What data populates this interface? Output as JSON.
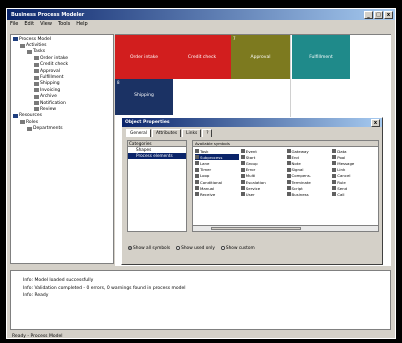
{
  "window": {
    "title": "Business Process Modeler",
    "controls": {
      "min": "_",
      "max": "□",
      "close": "x"
    }
  },
  "menubar": {
    "items": [
      "File",
      "Edit",
      "View",
      "Tools",
      "Help"
    ]
  },
  "tree": {
    "items": [
      {
        "label": "Process Model",
        "indent": 0,
        "icon": "b"
      },
      {
        "label": "Activities",
        "indent": 1,
        "icon": "g"
      },
      {
        "label": "Tasks",
        "indent": 2,
        "icon": "g"
      },
      {
        "label": "Order intake",
        "indent": 3,
        "icon": "g"
      },
      {
        "label": "Credit check",
        "indent": 3,
        "icon": "g"
      },
      {
        "label": "Approval",
        "indent": 3,
        "icon": "g"
      },
      {
        "label": "Fulfillment",
        "indent": 3,
        "icon": "g"
      },
      {
        "label": "Shipping",
        "indent": 3,
        "icon": "g"
      },
      {
        "label": "Invoicing",
        "indent": 3,
        "icon": "g"
      },
      {
        "label": "Archive",
        "indent": 3,
        "icon": "g"
      },
      {
        "label": "Notification",
        "indent": 3,
        "icon": "g"
      },
      {
        "label": "Review",
        "indent": 3,
        "icon": "g"
      },
      {
        "label": "Resources",
        "indent": 0,
        "icon": "b"
      },
      {
        "label": "Roles",
        "indent": 1,
        "icon": "g"
      },
      {
        "label": "Departments",
        "indent": 2,
        "icon": "g"
      }
    ]
  },
  "tiles": [
    {
      "label": "Order intake",
      "num": "",
      "color": "#d21e1e"
    },
    {
      "label": "Credit check",
      "num": "",
      "color": "#d21e1e"
    },
    {
      "label": "Approval",
      "num": "7",
      "color": "#7d7a1f"
    },
    {
      "label": "Fulfillment",
      "num": "",
      "color": "#1f8a8a"
    },
    {
      "label": "Shipping",
      "num": "8",
      "color": "#1b3264"
    }
  ],
  "dialog": {
    "title": "Object Properties",
    "tabs": [
      "General",
      "Attributes",
      "Links",
      "?"
    ],
    "left": {
      "header": "Categories",
      "items": [
        "Shapes",
        "Process elements"
      ]
    },
    "right": {
      "header": "Available symbols",
      "cells": [
        "Task",
        "Event",
        "Gateway",
        "Data",
        "Subprocess",
        "Start",
        "End",
        "Pool",
        "Lane",
        "Group",
        "Note",
        "Message",
        "Timer",
        "Error",
        "Signal",
        "Link",
        "Loop",
        "Multi",
        "Compens.",
        "Cancel",
        "Conditional",
        "Escalation",
        "Terminate",
        "Rule",
        "Manual",
        "Service",
        "Script",
        "Send",
        "Receive",
        "User",
        "Business",
        "Call"
      ],
      "selected": 4
    },
    "options": [
      {
        "label": "Show all symbols",
        "on": true
      },
      {
        "label": "Show used only",
        "on": false
      },
      {
        "label": "Show custom",
        "on": false
      }
    ]
  },
  "output": {
    "lines": [
      "Info: Model loaded successfully",
      "Info: Validation completed - 0 errors, 0 warnings found in process model",
      "Info: Ready"
    ]
  },
  "statusbar": {
    "text": "Ready  -  Process Model"
  }
}
